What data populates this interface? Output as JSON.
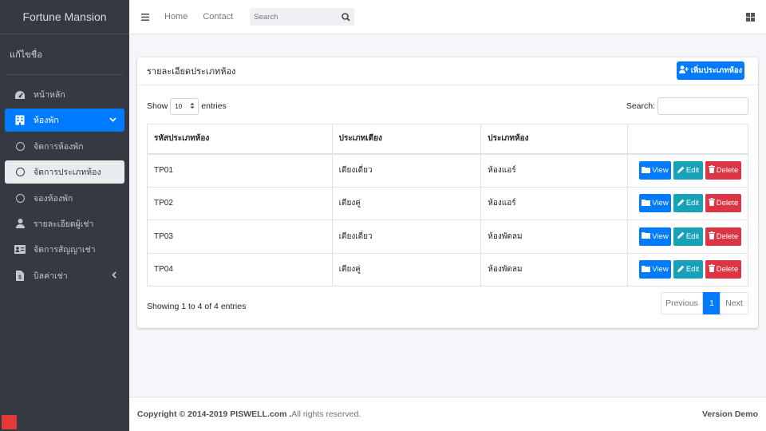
{
  "sidebar": {
    "brand": "Fortune Mansion",
    "user": "แก้ไขชื่อ",
    "items": [
      {
        "label": "หน้าหลัก",
        "icon": "tachometer-icon"
      },
      {
        "label": "ห้องพัก",
        "icon": "building-icon"
      },
      {
        "label": "จัดการห้องพัก",
        "icon": "circle-icon"
      },
      {
        "label": "จัดการประเภทห้อง",
        "icon": "circle-icon"
      },
      {
        "label": "จองห้องพัก",
        "icon": "circle-icon"
      },
      {
        "label": "รายละเอียดผู้เช่า",
        "icon": "user-icon"
      },
      {
        "label": "จัดการสัญญาเช่า",
        "icon": "id-card-icon"
      },
      {
        "label": "บิลค่าเช่า",
        "icon": "file-invoice-icon"
      }
    ]
  },
  "navbar": {
    "home": "Home",
    "contact": "Contact",
    "search_placeholder": "Search"
  },
  "card": {
    "title": "รายละเอียดประเภทห้อง",
    "add_button": "เพิ่มประเภทห้อง",
    "show_label": "Show",
    "entries_value": "10",
    "entries_label": "entries",
    "search_label": "Search:",
    "columns": [
      "รหัสประเภทห้อง",
      "ประเภทเตียง",
      "ประเภทห้อง",
      ""
    ],
    "rows": [
      {
        "code": "TP01",
        "bed": "เตียงเดี่ยว",
        "room": "ห้องแอร์"
      },
      {
        "code": "TP02",
        "bed": "เตียงคู่",
        "room": "ห้องแอร์"
      },
      {
        "code": "TP03",
        "bed": "เตียงเดี่ยว",
        "room": "ห้องพัดลม"
      },
      {
        "code": "TP04",
        "bed": "เตียงคู่",
        "room": "ห้องพัดลม"
      }
    ],
    "actions": {
      "view": "View",
      "edit": "Edit",
      "delete": "Delete"
    },
    "info": "Showing 1 to 4 of 4 entries",
    "pagination": {
      "prev": "Previous",
      "current": "1",
      "next": "Next"
    }
  },
  "footer": {
    "copyright": "Copyright © 2014-2019 PISWELL.com .",
    "rights": " All rights reserved.",
    "version": "Version Demo"
  },
  "colors": {
    "primary": "#007bff",
    "info": "#17a2b8",
    "danger": "#dc3545",
    "sidebar": "#343a40"
  }
}
